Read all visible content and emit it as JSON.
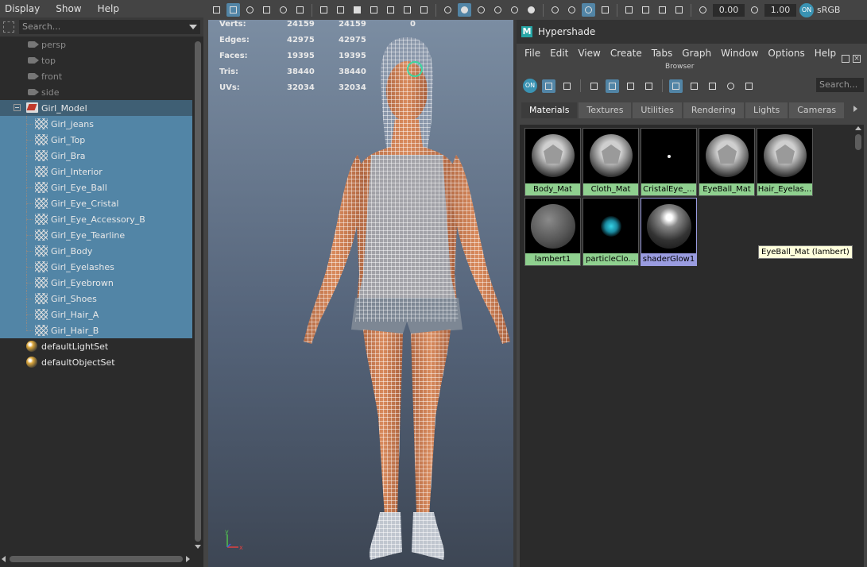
{
  "outliner": {
    "menu": [
      "Display",
      "Show",
      "Help"
    ],
    "search_placeholder": "Search...",
    "cameras": [
      "persp",
      "top",
      "front",
      "side"
    ],
    "group": "Girl_Model",
    "children": [
      "Girl_jeans",
      "Girl_Top",
      "Girl_Bra",
      "Girl_Interior",
      "Girl_Eye_Ball",
      "Girl_Eye_Cristal",
      "Girl_Eye_Accessory_B",
      "Girl_Eye_Tearline",
      "Girl_Body",
      "Girl_Eyelashes",
      "Girl_Eyebrown",
      "Girl_Shoes",
      "Girl_Hair_A",
      "Girl_Hair_B"
    ],
    "sets": [
      "defaultLightSet",
      "defaultObjectSet"
    ]
  },
  "viewport": {
    "toolbar": {
      "field1": "0.00",
      "field2": "1.00",
      "on_label": "ON",
      "colorspace": "sRGB"
    },
    "hud": [
      {
        "label": "Verts:",
        "a": "24159",
        "b": "24159",
        "c": "0"
      },
      {
        "label": "Edges:",
        "a": "42975",
        "b": "42975",
        "c": ""
      },
      {
        "label": "Faces:",
        "a": "19395",
        "b": "19395",
        "c": ""
      },
      {
        "label": "Tris:",
        "a": "38440",
        "b": "38440",
        "c": ""
      },
      {
        "label": "UVs:",
        "a": "32034",
        "b": "32034",
        "c": ""
      }
    ],
    "axis": {
      "y": "y",
      "x": "x"
    }
  },
  "hypershade": {
    "title": "Hypershade",
    "logo": "M",
    "menu": [
      "File",
      "Edit",
      "View",
      "Create",
      "Tabs",
      "Graph",
      "Window",
      "Options",
      "Help"
    ],
    "browser_label": "Browser",
    "on_label": "ON",
    "search_placeholder": "Search...",
    "tabs": [
      "Materials",
      "Textures",
      "Utilities",
      "Rendering",
      "Lights",
      "Cameras"
    ],
    "active_tab": "Materials",
    "swatches": [
      "Body_Mat",
      "Cloth_Mat",
      "CristalEye_...",
      "EyeBall_Mat",
      "Hair_Eyelas...",
      "lambert1",
      "particleClo...",
      "shaderGlow1"
    ],
    "tooltip": "EyeBall_Mat (lambert)"
  },
  "colors": {
    "selection": "#5285a6",
    "swatch_label": "#8fd08f",
    "swatch_label_selected": "#9a9ce0",
    "panel_dark": "#2b2b2b"
  }
}
